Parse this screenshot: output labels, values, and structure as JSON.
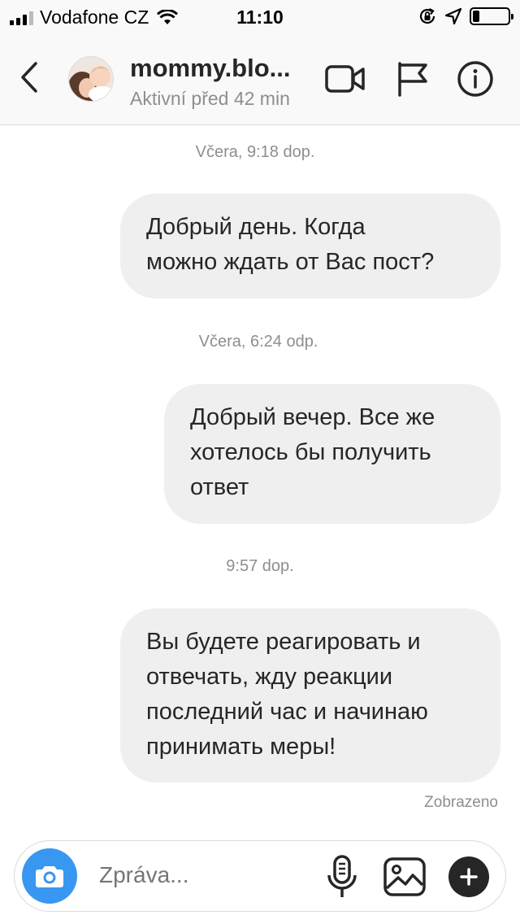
{
  "status_bar": {
    "carrier": "Vodafone CZ",
    "time": "11:10",
    "signal_bars_filled": 3,
    "battery_level": 0.2
  },
  "header": {
    "username": "mommy.blo...",
    "activity": "Aktivní před 42 min",
    "icons": [
      "back-icon",
      "avatar",
      "video-camera-icon",
      "flag-icon",
      "info-icon"
    ]
  },
  "messages": [
    {
      "timestamp": "Včera, 9:18 dop.",
      "lines": [
        "Добрый день. Когда",
        "можно ждать от Вас пост?"
      ]
    },
    {
      "timestamp": "Včera, 6:24 odp.",
      "lines": [
        "Добрый вечер. Все же",
        "хотелось бы получить",
        "ответ"
      ]
    },
    {
      "timestamp": "9:57 dop.",
      "lines": [
        "Вы будете реагировать и",
        "отвечать, жду реакции",
        "последний час и начинаю",
        "принимать меры!"
      ]
    }
  ],
  "seen_label": "Zobrazeno",
  "composer": {
    "placeholder": "Zpráva...",
    "icons": [
      "camera-icon",
      "microphone-icon",
      "gallery-icon",
      "plus-icon"
    ],
    "accent_color": "#3897f0"
  }
}
